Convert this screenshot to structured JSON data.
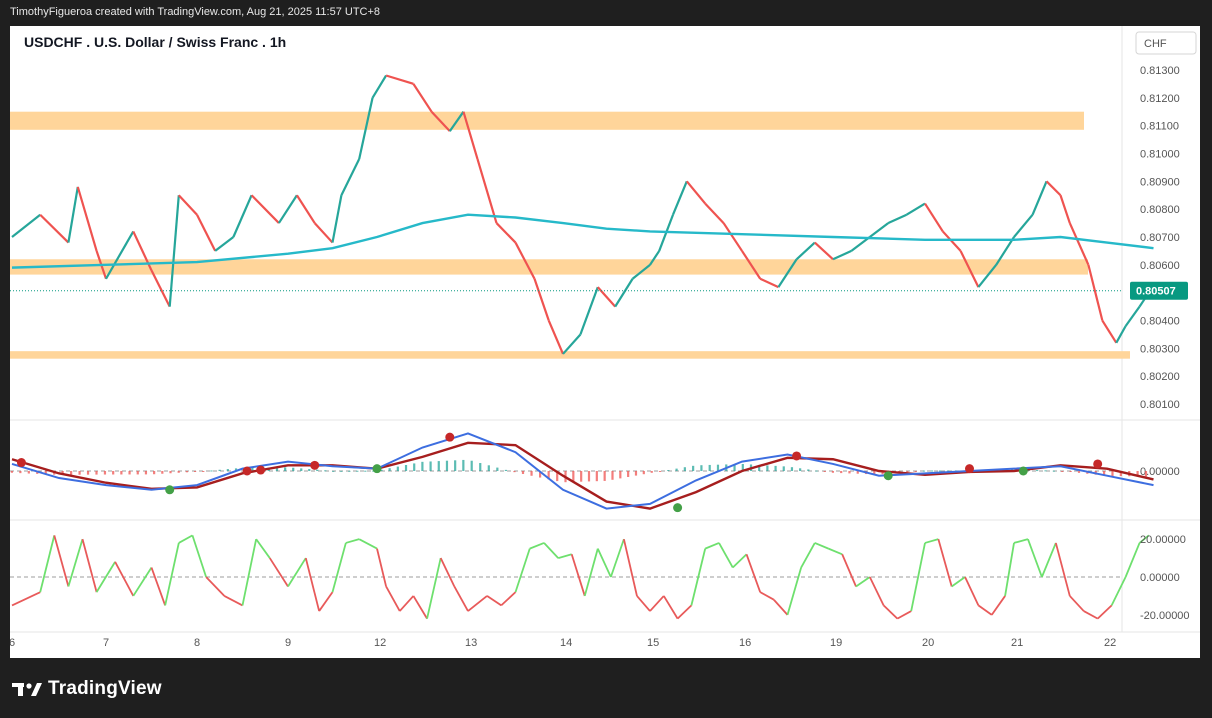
{
  "header": {
    "attribution": "TimothyFigueroa created with TradingView.com, Aug 21, 2025 11:57 UTC+8"
  },
  "brand": {
    "name": "TradingView"
  },
  "chart_data": [
    {
      "type": "line",
      "title": "USDCHF . U.S. Dollar / Swiss Franc . 1h",
      "currency_label": "CHF",
      "last_price": "0.80507",
      "ylim": [
        0.8005,
        0.8135
      ],
      "y_ticks": [
        "0.81300",
        "0.81200",
        "0.81100",
        "0.81000",
        "0.80900",
        "0.80800",
        "0.80700",
        "0.80600",
        "0.80400",
        "0.80300",
        "0.80200",
        "0.80100"
      ],
      "x_ticks": [
        "6",
        "7",
        "8",
        "9",
        "12",
        "13",
        "14",
        "15",
        "16",
        "19",
        "20",
        "21",
        "22"
      ],
      "zones": [
        {
          "from": 0.81085,
          "to": 0.8115
        },
        {
          "from": 0.80565,
          "to": 0.8062
        },
        {
          "from": 0.80263,
          "to": 0.8029
        }
      ],
      "price_points": [
        {
          "t": 6.0,
          "p": 0.807
        },
        {
          "t": 6.3,
          "p": 0.8078
        },
        {
          "t": 6.6,
          "p": 0.8068
        },
        {
          "t": 6.7,
          "p": 0.8088
        },
        {
          "t": 6.9,
          "p": 0.8065
        },
        {
          "t": 7.0,
          "p": 0.8055
        },
        {
          "t": 7.3,
          "p": 0.8072
        },
        {
          "t": 7.5,
          "p": 0.8058
        },
        {
          "t": 7.7,
          "p": 0.8045
        },
        {
          "t": 7.8,
          "p": 0.8085
        },
        {
          "t": 8.0,
          "p": 0.8078
        },
        {
          "t": 8.2,
          "p": 0.8065
        },
        {
          "t": 8.4,
          "p": 0.807
        },
        {
          "t": 8.6,
          "p": 0.8085
        },
        {
          "t": 8.9,
          "p": 0.8075
        },
        {
          "t": 9.1,
          "p": 0.8085
        },
        {
          "t": 9.3,
          "p": 0.8075
        },
        {
          "t": 9.5,
          "p": 0.8068
        },
        {
          "t": 9.6,
          "p": 0.8085
        },
        {
          "t": 9.8,
          "p": 0.8098
        },
        {
          "t": 9.95,
          "p": 0.812
        },
        {
          "t": 10.1,
          "p": 0.8128
        },
        {
          "t": 10.4,
          "p": 0.8125
        },
        {
          "t": 10.6,
          "p": 0.8115
        },
        {
          "t": 10.8,
          "p": 0.8108
        },
        {
          "t": 10.95,
          "p": 0.8115
        },
        {
          "t": 11.1,
          "p": 0.8098
        },
        {
          "t": 11.3,
          "p": 0.8075
        },
        {
          "t": 11.5,
          "p": 0.8068
        },
        {
          "t": 11.7,
          "p": 0.8055
        },
        {
          "t": 11.85,
          "p": 0.804
        },
        {
          "t": 12.0,
          "p": 0.8028
        },
        {
          "t": 12.2,
          "p": 0.8035
        },
        {
          "t": 12.4,
          "p": 0.8052
        },
        {
          "t": 12.6,
          "p": 0.8045
        },
        {
          "t": 12.8,
          "p": 0.8055
        },
        {
          "t": 13.0,
          "p": 0.806
        },
        {
          "t": 13.1,
          "p": 0.8065
        },
        {
          "t": 13.25,
          "p": 0.8078
        },
        {
          "t": 13.4,
          "p": 0.809
        },
        {
          "t": 13.6,
          "p": 0.8082
        },
        {
          "t": 13.8,
          "p": 0.8075
        },
        {
          "t": 14.0,
          "p": 0.8065
        },
        {
          "t": 14.2,
          "p": 0.8055
        },
        {
          "t": 14.4,
          "p": 0.8052
        },
        {
          "t": 14.6,
          "p": 0.8062
        },
        {
          "t": 14.8,
          "p": 0.8068
        },
        {
          "t": 15.0,
          "p": 0.8062
        },
        {
          "t": 15.2,
          "p": 0.8065
        },
        {
          "t": 15.4,
          "p": 0.807
        },
        {
          "t": 15.6,
          "p": 0.8075
        },
        {
          "t": 15.8,
          "p": 0.8078
        },
        {
          "t": 16.0,
          "p": 0.8082
        },
        {
          "t": 16.2,
          "p": 0.8072
        },
        {
          "t": 16.4,
          "p": 0.8065
        },
        {
          "t": 16.6,
          "p": 0.8052
        },
        {
          "t": 16.8,
          "p": 0.806
        },
        {
          "t": 17.0,
          "p": 0.807
        },
        {
          "t": 17.2,
          "p": 0.8078
        },
        {
          "t": 17.35,
          "p": 0.809
        },
        {
          "t": 17.5,
          "p": 0.8085
        },
        {
          "t": 17.6,
          "p": 0.8075
        },
        {
          "t": 17.8,
          "p": 0.806
        },
        {
          "t": 17.95,
          "p": 0.804
        },
        {
          "t": 18.1,
          "p": 0.8032
        },
        {
          "t": 18.2,
          "p": 0.8038
        },
        {
          "t": 18.35,
          "p": 0.8045
        },
        {
          "t": 18.45,
          "p": 0.805
        }
      ],
      "ma_points": [
        {
          "t": 6.0,
          "p": 0.8059
        },
        {
          "t": 7.0,
          "p": 0.806
        },
        {
          "t": 8.0,
          "p": 0.8061
        },
        {
          "t": 9.0,
          "p": 0.8064
        },
        {
          "t": 9.5,
          "p": 0.8066
        },
        {
          "t": 10.0,
          "p": 0.807
        },
        {
          "t": 10.5,
          "p": 0.8075
        },
        {
          "t": 11.0,
          "p": 0.8078
        },
        {
          "t": 11.5,
          "p": 0.8077
        },
        {
          "t": 12.0,
          "p": 0.8075
        },
        {
          "t": 12.5,
          "p": 0.8073
        },
        {
          "t": 13.0,
          "p": 0.8072
        },
        {
          "t": 14.0,
          "p": 0.8071
        },
        {
          "t": 15.0,
          "p": 0.807
        },
        {
          "t": 16.0,
          "p": 0.8069
        },
        {
          "t": 17.0,
          "p": 0.8069
        },
        {
          "t": 17.5,
          "p": 0.807
        },
        {
          "t": 18.0,
          "p": 0.8068
        },
        {
          "t": 18.5,
          "p": 0.8066
        }
      ]
    },
    {
      "type": "line",
      "title": "",
      "zero_label": "0.00000",
      "ylim": [
        -1.0,
        1.0
      ],
      "fast": [
        {
          "t": 6.0,
          "v": 0.15
        },
        {
          "t": 6.5,
          "v": -0.15
        },
        {
          "t": 7.0,
          "v": -0.3
        },
        {
          "t": 7.5,
          "v": -0.4
        },
        {
          "t": 8.0,
          "v": -0.3
        },
        {
          "t": 8.5,
          "v": 0.05
        },
        {
          "t": 9.0,
          "v": 0.2
        },
        {
          "t": 9.5,
          "v": 0.1
        },
        {
          "t": 10.0,
          "v": 0.05
        },
        {
          "t": 10.5,
          "v": 0.5
        },
        {
          "t": 11.0,
          "v": 0.8
        },
        {
          "t": 11.5,
          "v": 0.4
        },
        {
          "t": 12.0,
          "v": -0.4
        },
        {
          "t": 12.5,
          "v": -0.8
        },
        {
          "t": 13.0,
          "v": -0.7
        },
        {
          "t": 13.5,
          "v": -0.2
        },
        {
          "t": 14.0,
          "v": 0.2
        },
        {
          "t": 14.5,
          "v": 0.35
        },
        {
          "t": 15.0,
          "v": 0.15
        },
        {
          "t": 15.5,
          "v": -0.1
        },
        {
          "t": 16.0,
          "v": -0.05
        },
        {
          "t": 16.5,
          "v": 0.0
        },
        {
          "t": 17.0,
          "v": 0.05
        },
        {
          "t": 17.5,
          "v": 0.1
        },
        {
          "t": 18.0,
          "v": -0.1
        },
        {
          "t": 18.5,
          "v": -0.3
        }
      ],
      "slow": [
        {
          "t": 6.0,
          "v": 0.25
        },
        {
          "t": 6.5,
          "v": -0.05
        },
        {
          "t": 7.0,
          "v": -0.25
        },
        {
          "t": 7.5,
          "v": -0.38
        },
        {
          "t": 8.0,
          "v": -0.35
        },
        {
          "t": 8.5,
          "v": -0.05
        },
        {
          "t": 9.0,
          "v": 0.12
        },
        {
          "t": 9.5,
          "v": 0.12
        },
        {
          "t": 10.0,
          "v": 0.05
        },
        {
          "t": 10.5,
          "v": 0.3
        },
        {
          "t": 11.0,
          "v": 0.6
        },
        {
          "t": 11.5,
          "v": 0.55
        },
        {
          "t": 12.0,
          "v": -0.1
        },
        {
          "t": 12.5,
          "v": -0.65
        },
        {
          "t": 13.0,
          "v": -0.8
        },
        {
          "t": 13.5,
          "v": -0.45
        },
        {
          "t": 14.0,
          "v": 0.0
        },
        {
          "t": 14.5,
          "v": 0.28
        },
        {
          "t": 15.0,
          "v": 0.25
        },
        {
          "t": 15.5,
          "v": 0.0
        },
        {
          "t": 16.0,
          "v": -0.08
        },
        {
          "t": 16.5,
          "v": -0.02
        },
        {
          "t": 17.0,
          "v": 0.0
        },
        {
          "t": 17.5,
          "v": 0.12
        },
        {
          "t": 18.0,
          "v": 0.05
        },
        {
          "t": 18.5,
          "v": -0.18
        }
      ],
      "cross_points": [
        {
          "t": 6.1,
          "v": 0.18,
          "c": "#c62828"
        },
        {
          "t": 7.7,
          "v": -0.4,
          "c": "#43a047"
        },
        {
          "t": 8.55,
          "v": 0.0,
          "c": "#c62828"
        },
        {
          "t": 8.7,
          "v": 0.02,
          "c": "#c62828"
        },
        {
          "t": 9.3,
          "v": 0.12,
          "c": "#c62828"
        },
        {
          "t": 10.0,
          "v": 0.05,
          "c": "#43a047"
        },
        {
          "t": 10.8,
          "v": 0.72,
          "c": "#c62828"
        },
        {
          "t": 13.3,
          "v": -0.78,
          "c": "#43a047"
        },
        {
          "t": 14.6,
          "v": 0.32,
          "c": "#c62828"
        },
        {
          "t": 15.6,
          "v": -0.1,
          "c": "#43a047"
        },
        {
          "t": 16.5,
          "v": 0.05,
          "c": "#c62828"
        },
        {
          "t": 17.1,
          "v": 0.0,
          "c": "#43a047"
        },
        {
          "t": 17.9,
          "v": 0.15,
          "c": "#c62828"
        }
      ]
    },
    {
      "type": "line",
      "title": "",
      "y_ticks": [
        "20.00000",
        "0.00000",
        "-20.00000"
      ],
      "ylim": [
        -28,
        28
      ],
      "points": [
        {
          "t": 6.0,
          "v": -15
        },
        {
          "t": 6.3,
          "v": -8
        },
        {
          "t": 6.45,
          "v": 22
        },
        {
          "t": 6.6,
          "v": -5
        },
        {
          "t": 6.75,
          "v": 20
        },
        {
          "t": 6.9,
          "v": -8
        },
        {
          "t": 7.1,
          "v": 8
        },
        {
          "t": 7.3,
          "v": -10
        },
        {
          "t": 7.5,
          "v": 5
        },
        {
          "t": 7.65,
          "v": -15
        },
        {
          "t": 7.8,
          "v": 18
        },
        {
          "t": 7.95,
          "v": 22
        },
        {
          "t": 8.1,
          "v": 0
        },
        {
          "t": 8.3,
          "v": -10
        },
        {
          "t": 8.5,
          "v": -15
        },
        {
          "t": 8.65,
          "v": 20
        },
        {
          "t": 8.8,
          "v": 10
        },
        {
          "t": 9.0,
          "v": -5
        },
        {
          "t": 9.2,
          "v": 10
        },
        {
          "t": 9.35,
          "v": -18
        },
        {
          "t": 9.5,
          "v": -8
        },
        {
          "t": 9.65,
          "v": 18
        },
        {
          "t": 9.8,
          "v": 20
        },
        {
          "t": 10.0,
          "v": 15
        },
        {
          "t": 10.1,
          "v": -5
        },
        {
          "t": 10.25,
          "v": -18
        },
        {
          "t": 10.4,
          "v": -10
        },
        {
          "t": 10.55,
          "v": -22
        },
        {
          "t": 10.7,
          "v": 10
        },
        {
          "t": 10.85,
          "v": -5
        },
        {
          "t": 11.0,
          "v": -18
        },
        {
          "t": 11.2,
          "v": -10
        },
        {
          "t": 11.35,
          "v": -15
        },
        {
          "t": 11.5,
          "v": -8
        },
        {
          "t": 11.65,
          "v": 15
        },
        {
          "t": 11.8,
          "v": 18
        },
        {
          "t": 11.95,
          "v": 10
        },
        {
          "t": 12.1,
          "v": 12
        },
        {
          "t": 12.25,
          "v": -10
        },
        {
          "t": 12.4,
          "v": 15
        },
        {
          "t": 12.55,
          "v": 0
        },
        {
          "t": 12.7,
          "v": 20
        },
        {
          "t": 12.85,
          "v": -10
        },
        {
          "t": 13.0,
          "v": -18
        },
        {
          "t": 13.15,
          "v": -10
        },
        {
          "t": 13.3,
          "v": -22
        },
        {
          "t": 13.45,
          "v": -15
        },
        {
          "t": 13.6,
          "v": 15
        },
        {
          "t": 13.75,
          "v": 18
        },
        {
          "t": 13.9,
          "v": 5
        },
        {
          "t": 14.05,
          "v": 12
        },
        {
          "t": 14.2,
          "v": -8
        },
        {
          "t": 14.35,
          "v": -12
        },
        {
          "t": 14.5,
          "v": -20
        },
        {
          "t": 14.65,
          "v": 5
        },
        {
          "t": 14.8,
          "v": 18
        },
        {
          "t": 14.95,
          "v": 15
        },
        {
          "t": 15.1,
          "v": 12
        },
        {
          "t": 15.25,
          "v": -5
        },
        {
          "t": 15.4,
          "v": 0
        },
        {
          "t": 15.55,
          "v": -15
        },
        {
          "t": 15.7,
          "v": -22
        },
        {
          "t": 15.85,
          "v": -18
        },
        {
          "t": 16.0,
          "v": 18
        },
        {
          "t": 16.15,
          "v": 20
        },
        {
          "t": 16.3,
          "v": -5
        },
        {
          "t": 16.45,
          "v": 0
        },
        {
          "t": 16.6,
          "v": -15
        },
        {
          "t": 16.75,
          "v": -20
        },
        {
          "t": 16.9,
          "v": -10
        },
        {
          "t": 17.0,
          "v": 18
        },
        {
          "t": 17.15,
          "v": 20
        },
        {
          "t": 17.3,
          "v": 0
        },
        {
          "t": 17.45,
          "v": 18
        },
        {
          "t": 17.6,
          "v": -10
        },
        {
          "t": 17.75,
          "v": -18
        },
        {
          "t": 17.9,
          "v": -22
        },
        {
          "t": 18.05,
          "v": -15
        },
        {
          "t": 18.2,
          "v": 0
        },
        {
          "t": 18.35,
          "v": 18
        },
        {
          "t": 18.45,
          "v": 22
        }
      ]
    }
  ],
  "colors": {
    "zone": "#ffd59a",
    "ma_line": "#26b9c9",
    "up": "#26a69a",
    "down": "#ef5350",
    "last_price_bg": "#089981",
    "fast_line": "#3d6ee0",
    "slow_line": "#a61e1e",
    "osc_up": "#6ee06e",
    "osc_down": "#e85a5a"
  }
}
